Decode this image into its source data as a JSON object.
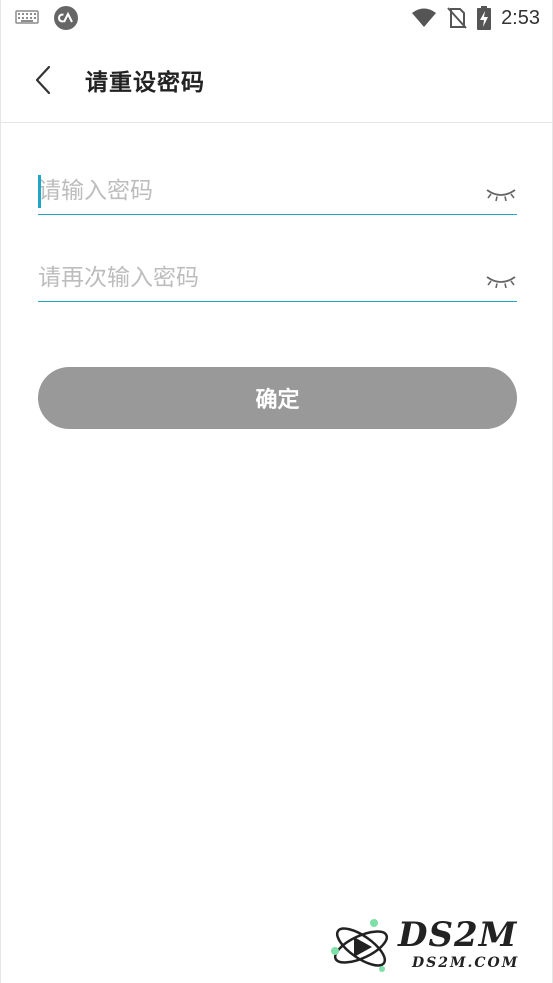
{
  "status_bar": {
    "time": "2:53",
    "icons": [
      "keyboard-icon",
      "app-notification-icon",
      "wifi-icon",
      "no-sim-icon",
      "battery-charging-icon"
    ]
  },
  "header": {
    "back_icon": "chevron-left-icon",
    "title": "请重设密码"
  },
  "form": {
    "password": {
      "value": "",
      "placeholder": "请输入密码",
      "toggle_icon": "eye-closed-icon"
    },
    "confirm_password": {
      "value": "",
      "placeholder": "请再次输入密码",
      "toggle_icon": "eye-closed-icon"
    },
    "submit_label": "确定"
  },
  "watermark": {
    "main": "DS2M",
    "sub": "DS2M.COM"
  },
  "colors": {
    "accent": "#1ea6c4",
    "button_disabled": "#999999",
    "placeholder": "#bdbdbd",
    "title": "#222222"
  }
}
